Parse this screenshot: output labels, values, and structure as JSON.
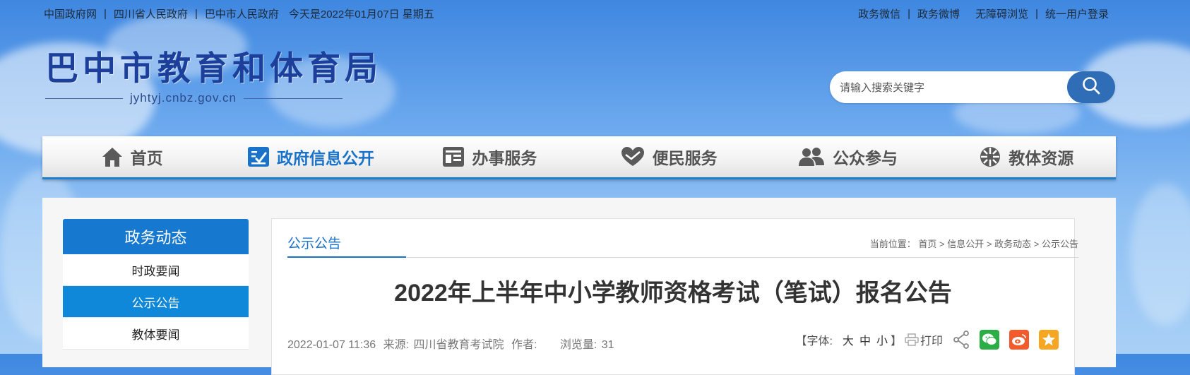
{
  "topbar": {
    "left_links": [
      "中国政府网",
      "四川省人民政府",
      "巴中市人民政府"
    ],
    "date_text": "今天是2022年01月07日 星期五",
    "right_links": [
      "政务微信",
      "政务微博",
      "无障碍浏览",
      "统一用户登录"
    ],
    "separator": "|"
  },
  "logo": {
    "name": "巴中市教育和体育局",
    "domain": "jyhtyj.cnbz.gov.cn"
  },
  "search": {
    "placeholder": "请输入搜索关键字",
    "icon": "search-icon"
  },
  "nav": {
    "items": [
      {
        "label": "首页",
        "icon": "home-icon"
      },
      {
        "label": "政府信息公开",
        "icon": "checklist-icon"
      },
      {
        "label": "办事服务",
        "icon": "service-icon"
      },
      {
        "label": "便民服务",
        "icon": "heart-hands-icon"
      },
      {
        "label": "公众参与",
        "icon": "people-icon"
      },
      {
        "label": "教体资源",
        "icon": "resource-icon"
      }
    ],
    "active_index": 1,
    "active_color": "#1a73c9"
  },
  "sidebar": {
    "title": "政务动态",
    "items": [
      "时政要闻",
      "公示公告",
      "教体要闻"
    ],
    "active_index": 1
  },
  "main": {
    "tab": "公示公告",
    "breadcrumb": {
      "prefix": "当前位置：",
      "items": [
        "首页",
        "信息公开",
        "政务动态",
        "公示公告"
      ],
      "separator": ">"
    },
    "title": "2022年上半年中小学教师资格考试（笔试）报名公告",
    "meta": {
      "datetime": "2022-01-07 11:36",
      "source_label": "来源:",
      "source": "四川省教育考试院",
      "author_label": "作者:",
      "views_label": "浏览量:",
      "views": "31"
    },
    "tools": {
      "font_label": "【字体:",
      "sizes": [
        "大",
        "中",
        "小"
      ],
      "close_bracket": "】",
      "print_label": "打印"
    }
  },
  "colors": {
    "brand_blue": "#1678cf",
    "wechat_green": "#2aae45",
    "weibo_orange": "#f35a2c",
    "favorite_orange": "#f5a623"
  }
}
